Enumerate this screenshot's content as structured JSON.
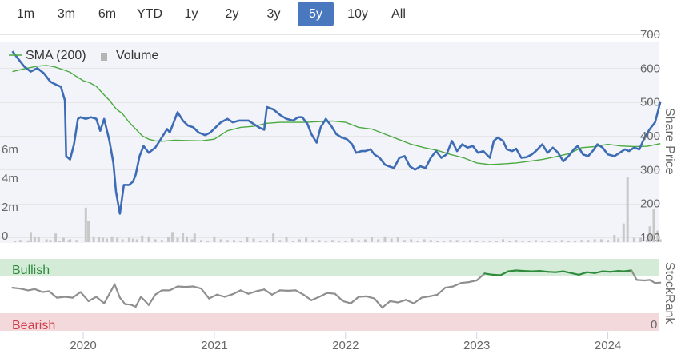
{
  "range_buttons": [
    {
      "label": "1m",
      "active": false
    },
    {
      "label": "3m",
      "active": false
    },
    {
      "label": "6m",
      "active": false
    },
    {
      "label": "YTD",
      "active": false
    },
    {
      "label": "1y",
      "active": false
    },
    {
      "label": "2y",
      "active": false
    },
    {
      "label": "3y",
      "active": false
    },
    {
      "label": "5y",
      "active": true
    },
    {
      "label": "10y",
      "active": false
    },
    {
      "label": "All",
      "active": false
    }
  ],
  "legend": {
    "sma_label": "SMA (200)",
    "volume_label": "Volume"
  },
  "colors": {
    "price": "#3d6cb5",
    "sma": "#4aaa3f",
    "volume": "#c8c8c8",
    "stockrank": "#8f8f8f",
    "stockrank_bullish": "#2e8b3c",
    "bullish_band": "#d4ebd8",
    "bearish_band": "#f3d9db",
    "bullish_text": "#2e8b3c",
    "bearish_text": "#d0404c",
    "active_button": "#4a78be"
  },
  "chart_data": {
    "type": "line",
    "x_axis": {
      "ticks": [
        "2020",
        "2021",
        "2022",
        "2023",
        "2024"
      ]
    },
    "price_axis": {
      "title": "Share Price",
      "ticks": [
        100,
        200,
        300,
        400,
        500,
        600,
        700
      ],
      "ylim": [
        100,
        700
      ]
    },
    "volume_axis": {
      "ticks": [
        "0",
        "2m",
        "4m",
        "6m"
      ],
      "ylim": [
        0,
        6000000
      ]
    },
    "stockrank_axis": {
      "title": "StockRank",
      "ticks": [
        "0"
      ],
      "ylim": [
        0,
        100
      ]
    },
    "bands": {
      "bullish_label": "Bullish",
      "bearish_label": "Bearish"
    },
    "price": [
      [
        2019.46,
        650
      ],
      [
        2019.52,
        620
      ],
      [
        2019.55,
        605
      ],
      [
        2019.6,
        590
      ],
      [
        2019.65,
        600
      ],
      [
        2019.7,
        585
      ],
      [
        2019.75,
        560
      ],
      [
        2019.8,
        550
      ],
      [
        2019.83,
        545
      ],
      [
        2019.86,
        505
      ],
      [
        2019.87,
        340
      ],
      [
        2019.9,
        330
      ],
      [
        2019.93,
        375
      ],
      [
        2019.96,
        450
      ],
      [
        2019.98,
        455
      ],
      [
        2020.02,
        450
      ],
      [
        2020.06,
        455
      ],
      [
        2020.1,
        450
      ],
      [
        2020.13,
        415
      ],
      [
        2020.16,
        450
      ],
      [
        2020.2,
        385
      ],
      [
        2020.23,
        320
      ],
      [
        2020.25,
        235
      ],
      [
        2020.28,
        170
      ],
      [
        2020.31,
        255
      ],
      [
        2020.35,
        255
      ],
      [
        2020.38,
        265
      ],
      [
        2020.4,
        285
      ],
      [
        2020.43,
        340
      ],
      [
        2020.46,
        370
      ],
      [
        2020.5,
        350
      ],
      [
        2020.55,
        365
      ],
      [
        2020.6,
        395
      ],
      [
        2020.64,
        420
      ],
      [
        2020.66,
        410
      ],
      [
        2020.68,
        430
      ],
      [
        2020.72,
        470
      ],
      [
        2020.76,
        445
      ],
      [
        2020.8,
        430
      ],
      [
        2020.84,
        425
      ],
      [
        2020.88,
        410
      ],
      [
        2020.93,
        402
      ],
      [
        2020.97,
        410
      ],
      [
        2021.01,
        425
      ],
      [
        2021.05,
        440
      ],
      [
        2021.1,
        450
      ],
      [
        2021.14,
        440
      ],
      [
        2021.19,
        445
      ],
      [
        2021.23,
        445
      ],
      [
        2021.26,
        445
      ],
      [
        2021.3,
        435
      ],
      [
        2021.34,
        425
      ],
      [
        2021.38,
        418
      ],
      [
        2021.4,
        485
      ],
      [
        2021.45,
        478
      ],
      [
        2021.5,
        462
      ],
      [
        2021.55,
        450
      ],
      [
        2021.6,
        445
      ],
      [
        2021.64,
        455
      ],
      [
        2021.67,
        455
      ],
      [
        2021.71,
        435
      ],
      [
        2021.74,
        405
      ],
      [
        2021.78,
        380
      ],
      [
        2021.81,
        425
      ],
      [
        2021.85,
        450
      ],
      [
        2021.89,
        430
      ],
      [
        2021.93,
        405
      ],
      [
        2021.97,
        395
      ],
      [
        2022.01,
        390
      ],
      [
        2022.05,
        375
      ],
      [
        2022.08,
        350
      ],
      [
        2022.12,
        355
      ],
      [
        2022.15,
        355
      ],
      [
        2022.19,
        360
      ],
      [
        2022.22,
        345
      ],
      [
        2022.26,
        335
      ],
      [
        2022.3,
        315
      ],
      [
        2022.33,
        310
      ],
      [
        2022.37,
        305
      ],
      [
        2022.41,
        335
      ],
      [
        2022.45,
        340
      ],
      [
        2022.49,
        310
      ],
      [
        2022.53,
        300
      ],
      [
        2022.57,
        310
      ],
      [
        2022.61,
        305
      ],
      [
        2022.65,
        335
      ],
      [
        2022.69,
        355
      ],
      [
        2022.73,
        335
      ],
      [
        2022.77,
        345
      ],
      [
        2022.81,
        385
      ],
      [
        2022.85,
        355
      ],
      [
        2022.89,
        375
      ],
      [
        2022.93,
        365
      ],
      [
        2022.97,
        370
      ],
      [
        2023.01,
        350
      ],
      [
        2023.05,
        355
      ],
      [
        2023.1,
        335
      ],
      [
        2023.13,
        385
      ],
      [
        2023.16,
        395
      ],
      [
        2023.2,
        385
      ],
      [
        2023.23,
        360
      ],
      [
        2023.27,
        355
      ],
      [
        2023.3,
        362
      ],
      [
        2023.34,
        335
      ],
      [
        2023.38,
        337
      ],
      [
        2023.42,
        345
      ],
      [
        2023.45,
        355
      ],
      [
        2023.5,
        375
      ],
      [
        2023.54,
        350
      ],
      [
        2023.58,
        365
      ],
      [
        2023.62,
        350
      ],
      [
        2023.66,
        325
      ],
      [
        2023.7,
        340
      ],
      [
        2023.74,
        360
      ],
      [
        2023.77,
        370
      ],
      [
        2023.81,
        345
      ],
      [
        2023.85,
        340
      ],
      [
        2023.89,
        358
      ],
      [
        2023.92,
        375
      ],
      [
        2023.96,
        365
      ],
      [
        2024.0,
        345
      ],
      [
        2024.05,
        340
      ],
      [
        2024.09,
        350
      ],
      [
        2024.13,
        360
      ],
      [
        2024.16,
        355
      ],
      [
        2024.2,
        365
      ],
      [
        2024.24,
        360
      ],
      [
        2024.28,
        395
      ],
      [
        2024.32,
        420
      ],
      [
        2024.36,
        440
      ],
      [
        2024.4,
        500
      ]
    ],
    "sma": [
      [
        2019.46,
        590
      ],
      [
        2019.55,
        598
      ],
      [
        2019.65,
        606
      ],
      [
        2019.72,
        608
      ],
      [
        2019.78,
        604
      ],
      [
        2019.85,
        595
      ],
      [
        2019.9,
        588
      ],
      [
        2019.95,
        575
      ],
      [
        2020.0,
        563
      ],
      [
        2020.05,
        557
      ],
      [
        2020.1,
        546
      ],
      [
        2020.15,
        525
      ],
      [
        2020.2,
        505
      ],
      [
        2020.25,
        480
      ],
      [
        2020.3,
        465
      ],
      [
        2020.35,
        440
      ],
      [
        2020.4,
        420
      ],
      [
        2020.45,
        400
      ],
      [
        2020.5,
        390
      ],
      [
        2020.55,
        385
      ],
      [
        2020.6,
        384
      ],
      [
        2020.7,
        387
      ],
      [
        2020.8,
        386
      ],
      [
        2020.9,
        385
      ],
      [
        2021.0,
        390
      ],
      [
        2021.1,
        415
      ],
      [
        2021.2,
        425
      ],
      [
        2021.3,
        428
      ],
      [
        2021.4,
        437
      ],
      [
        2021.5,
        440
      ],
      [
        2021.6,
        440
      ],
      [
        2021.7,
        440
      ],
      [
        2021.8,
        442
      ],
      [
        2021.9,
        444
      ],
      [
        2022.0,
        440
      ],
      [
        2022.1,
        425
      ],
      [
        2022.2,
        420
      ],
      [
        2022.3,
        405
      ],
      [
        2022.4,
        390
      ],
      [
        2022.5,
        375
      ],
      [
        2022.6,
        365
      ],
      [
        2022.7,
        357
      ],
      [
        2022.8,
        345
      ],
      [
        2022.9,
        335
      ],
      [
        2023.0,
        320
      ],
      [
        2023.1,
        315
      ],
      [
        2023.2,
        317
      ],
      [
        2023.3,
        320
      ],
      [
        2023.4,
        325
      ],
      [
        2023.5,
        330
      ],
      [
        2023.6,
        338
      ],
      [
        2023.7,
        347
      ],
      [
        2023.8,
        365
      ],
      [
        2023.9,
        368
      ],
      [
        2024.0,
        375
      ],
      [
        2024.1,
        370
      ],
      [
        2024.2,
        368
      ],
      [
        2024.3,
        369
      ],
      [
        2024.4,
        377
      ]
    ],
    "stockrank": [
      [
        2019.46,
        59
      ],
      [
        2019.52,
        57
      ],
      [
        2019.58,
        53
      ],
      [
        2019.63,
        56
      ],
      [
        2019.69,
        49
      ],
      [
        2019.74,
        51
      ],
      [
        2019.8,
        36
      ],
      [
        2019.86,
        38
      ],
      [
        2019.92,
        36
      ],
      [
        2019.98,
        49
      ],
      [
        2020.04,
        28
      ],
      [
        2020.1,
        38
      ],
      [
        2020.16,
        23
      ],
      [
        2020.2,
        45
      ],
      [
        2020.24,
        67
      ],
      [
        2020.28,
        36
      ],
      [
        2020.32,
        21
      ],
      [
        2020.36,
        20
      ],
      [
        2020.4,
        15
      ],
      [
        2020.44,
        38
      ],
      [
        2020.47,
        29
      ],
      [
        2020.5,
        19
      ],
      [
        2020.55,
        43
      ],
      [
        2020.6,
        53
      ],
      [
        2020.66,
        53
      ],
      [
        2020.72,
        62
      ],
      [
        2020.78,
        61
      ],
      [
        2020.84,
        62
      ],
      [
        2020.9,
        57
      ],
      [
        2020.96,
        34
      ],
      [
        2021.02,
        43
      ],
      [
        2021.08,
        38
      ],
      [
        2021.14,
        44
      ],
      [
        2021.2,
        53
      ],
      [
        2021.26,
        45
      ],
      [
        2021.32,
        51
      ],
      [
        2021.38,
        55
      ],
      [
        2021.44,
        43
      ],
      [
        2021.5,
        53
      ],
      [
        2021.56,
        52
      ],
      [
        2021.62,
        53
      ],
      [
        2021.68,
        43
      ],
      [
        2021.74,
        30
      ],
      [
        2021.8,
        38
      ],
      [
        2021.86,
        47
      ],
      [
        2021.92,
        45
      ],
      [
        2021.98,
        28
      ],
      [
        2022.04,
        23
      ],
      [
        2022.1,
        38
      ],
      [
        2022.16,
        39
      ],
      [
        2022.22,
        34
      ],
      [
        2022.28,
        13
      ],
      [
        2022.34,
        28
      ],
      [
        2022.4,
        25
      ],
      [
        2022.46,
        31
      ],
      [
        2022.52,
        23
      ],
      [
        2022.58,
        36
      ],
      [
        2022.64,
        39
      ],
      [
        2022.7,
        43
      ],
      [
        2022.76,
        59
      ],
      [
        2022.82,
        62
      ],
      [
        2022.88,
        70
      ],
      [
        2022.94,
        72
      ],
      [
        2023.0,
        76
      ],
      [
        2023.06,
        92
      ],
      [
        2023.12,
        89
      ],
      [
        2023.18,
        88
      ],
      [
        2023.24,
        97
      ],
      [
        2023.3,
        99
      ],
      [
        2023.36,
        98
      ],
      [
        2023.42,
        97
      ],
      [
        2023.48,
        98
      ],
      [
        2023.54,
        96
      ],
      [
        2023.6,
        95
      ],
      [
        2023.66,
        97
      ],
      [
        2023.72,
        93
      ],
      [
        2023.78,
        89
      ],
      [
        2023.84,
        95
      ],
      [
        2023.9,
        93
      ],
      [
        2023.96,
        97
      ],
      [
        2024.02,
        96
      ],
      [
        2024.08,
        98
      ],
      [
        2024.12,
        97
      ],
      [
        2024.18,
        99
      ],
      [
        2024.22,
        77
      ],
      [
        2024.28,
        76
      ],
      [
        2024.32,
        77
      ],
      [
        2024.36,
        70
      ],
      [
        2024.4,
        71
      ]
    ],
    "volume": [
      [
        2019.48,
        100000
      ],
      [
        2019.52,
        150000
      ],
      [
        2019.58,
        120000
      ],
      [
        2019.6,
        700000
      ],
      [
        2019.63,
        400000
      ],
      [
        2019.66,
        350000
      ],
      [
        2019.72,
        200000
      ],
      [
        2019.75,
        150000
      ],
      [
        2019.79,
        600000
      ],
      [
        2019.82,
        100000
      ],
      [
        2019.85,
        300000
      ],
      [
        2019.89,
        150000
      ],
      [
        2019.9,
        200000
      ],
      [
        2019.95,
        150000
      ],
      [
        2020.02,
        2400000
      ],
      [
        2020.04,
        1500000
      ],
      [
        2020.08,
        400000
      ],
      [
        2020.12,
        350000
      ],
      [
        2020.15,
        300000
      ],
      [
        2020.18,
        250000
      ],
      [
        2020.22,
        400000
      ],
      [
        2020.26,
        300000
      ],
      [
        2020.3,
        200000
      ],
      [
        2020.35,
        300000
      ],
      [
        2020.38,
        250000
      ],
      [
        2020.41,
        200000
      ],
      [
        2020.45,
        450000
      ],
      [
        2020.5,
        400000
      ],
      [
        2020.55,
        200000
      ],
      [
        2020.6,
        150000
      ],
      [
        2020.65,
        350000
      ],
      [
        2020.68,
        700000
      ],
      [
        2020.72,
        300000
      ],
      [
        2020.76,
        650000
      ],
      [
        2020.79,
        400000
      ],
      [
        2020.83,
        200000
      ],
      [
        2020.85,
        600000
      ],
      [
        2020.9,
        150000
      ],
      [
        2020.95,
        100000
      ],
      [
        2021.0,
        400000
      ],
      [
        2021.05,
        200000
      ],
      [
        2021.1,
        150000
      ],
      [
        2021.15,
        150000
      ],
      [
        2021.2,
        100000
      ],
      [
        2021.25,
        350000
      ],
      [
        2021.3,
        250000
      ],
      [
        2021.35,
        100000
      ],
      [
        2021.4,
        150000
      ],
      [
        2021.45,
        600000
      ],
      [
        2021.5,
        150000
      ],
      [
        2021.55,
        350000
      ],
      [
        2021.6,
        100000
      ],
      [
        2021.65,
        200000
      ],
      [
        2021.7,
        300000
      ],
      [
        2021.75,
        150000
      ],
      [
        2021.8,
        150000
      ],
      [
        2021.85,
        100000
      ],
      [
        2021.9,
        150000
      ],
      [
        2021.95,
        100000
      ],
      [
        2022.0,
        100000
      ],
      [
        2022.05,
        250000
      ],
      [
        2022.1,
        150000
      ],
      [
        2022.15,
        200000
      ],
      [
        2022.2,
        350000
      ],
      [
        2022.25,
        200000
      ],
      [
        2022.3,
        400000
      ],
      [
        2022.35,
        250000
      ],
      [
        2022.4,
        350000
      ],
      [
        2022.45,
        150000
      ],
      [
        2022.5,
        200000
      ],
      [
        2022.55,
        100000
      ],
      [
        2022.6,
        200000
      ],
      [
        2022.65,
        150000
      ],
      [
        2022.7,
        100000
      ],
      [
        2022.75,
        100000
      ],
      [
        2022.8,
        150000
      ],
      [
        2022.85,
        150000
      ],
      [
        2022.9,
        100000
      ],
      [
        2022.95,
        150000
      ],
      [
        2023.0,
        100000
      ],
      [
        2023.05,
        100000
      ],
      [
        2023.1,
        100000
      ],
      [
        2023.15,
        100000
      ],
      [
        2023.2,
        200000
      ],
      [
        2023.25,
        100000
      ],
      [
        2023.3,
        150000
      ],
      [
        2023.35,
        100000
      ],
      [
        2023.4,
        100000
      ],
      [
        2023.45,
        150000
      ],
      [
        2023.5,
        100000
      ],
      [
        2023.55,
        100000
      ],
      [
        2023.6,
        100000
      ],
      [
        2023.65,
        150000
      ],
      [
        2023.7,
        100000
      ],
      [
        2023.75,
        100000
      ],
      [
        2023.8,
        150000
      ],
      [
        2023.85,
        150000
      ],
      [
        2023.9,
        200000
      ],
      [
        2023.95,
        200000
      ],
      [
        2024.0,
        150000
      ],
      [
        2024.05,
        500000
      ],
      [
        2024.08,
        250000
      ],
      [
        2024.12,
        1300000
      ],
      [
        2024.15,
        4500000
      ],
      [
        2024.2,
        300000
      ],
      [
        2024.25,
        300000
      ],
      [
        2024.3,
        200000
      ],
      [
        2024.32,
        1100000
      ],
      [
        2024.35,
        2300000
      ],
      [
        2024.38,
        800000
      ],
      [
        2024.4,
        200000
      ]
    ]
  }
}
